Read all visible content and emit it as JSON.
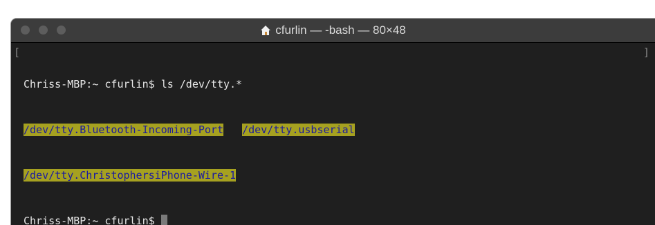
{
  "window": {
    "title": "cfurlin — -bash — 80×48",
    "title_icon": "home-icon"
  },
  "terminal": {
    "prompt": "Chriss-MBP:~ cfurlin$",
    "command": "ls /dev/tty.*",
    "output": [
      [
        "/dev/tty.Bluetooth-Incoming-Port",
        "/dev/tty.usbserial"
      ],
      [
        "/dev/tty.ChristophersiPhone-Wire-1"
      ]
    ],
    "left_bracket": "[",
    "right_bracket": "]"
  },
  "colors": {
    "highlight_bg": "#a6a120",
    "highlight_text": "#1a1aa0",
    "terminal_bg": "#1f1f1f",
    "titlebar_bg": "#3c3c3c"
  }
}
